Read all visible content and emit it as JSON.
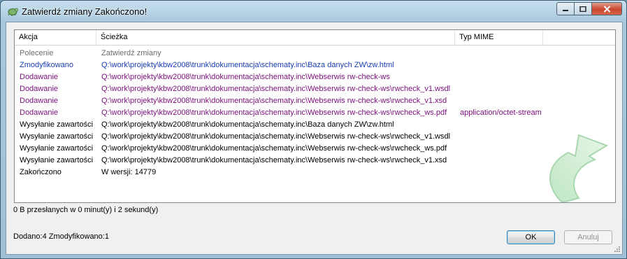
{
  "window": {
    "title": "Zatwierdź zmiany Zakończono!"
  },
  "list": {
    "columns": {
      "action": "Akcja",
      "path": "Ścieżka",
      "mime": "Typ MIME"
    },
    "rows": [
      {
        "action": "Polecenie",
        "path": "Zatwierdź zmiany",
        "mime": "",
        "style": "cmd"
      },
      {
        "action": "Zmodyfikowano",
        "path": "Q:\\work\\projekty\\kbw2008\\trunk\\dokumentacja\\schematy.inc\\Baza danych ZW\\zw.html",
        "mime": "",
        "style": "mod"
      },
      {
        "action": "Dodawanie",
        "path": "Q:\\work\\projekty\\kbw2008\\trunk\\dokumentacja\\schematy.inc\\Webserwis rw-check-ws",
        "mime": "",
        "style": "add"
      },
      {
        "action": "Dodawanie",
        "path": "Q:\\work\\projekty\\kbw2008\\trunk\\dokumentacja\\schematy.inc\\Webserwis rw-check-ws\\rwcheck_v1.wsdl",
        "mime": "",
        "style": "add"
      },
      {
        "action": "Dodawanie",
        "path": "Q:\\work\\projekty\\kbw2008\\trunk\\dokumentacja\\schematy.inc\\Webserwis rw-check-ws\\rwcheck_v1.xsd",
        "mime": "",
        "style": "add"
      },
      {
        "action": "Dodawanie",
        "path": "Q:\\work\\projekty\\kbw2008\\trunk\\dokumentacja\\schematy.inc\\Webserwis rw-check-ws\\rwcheck_ws.pdf",
        "mime": "application/octet-stream",
        "style": "add"
      },
      {
        "action": "Wysyłanie zawartości",
        "path": "Q:\\work\\projekty\\kbw2008\\trunk\\dokumentacja\\schematy.inc\\Baza danych ZW\\zw.html",
        "mime": "",
        "style": "norm"
      },
      {
        "action": "Wysyłanie zawartości",
        "path": "Q:\\work\\projekty\\kbw2008\\trunk\\dokumentacja\\schematy.inc\\Webserwis rw-check-ws\\rwcheck_v1.wsdl",
        "mime": "",
        "style": "norm"
      },
      {
        "action": "Wysyłanie zawartości",
        "path": "Q:\\work\\projekty\\kbw2008\\trunk\\dokumentacja\\schematy.inc\\Webserwis rw-check-ws\\rwcheck_ws.pdf",
        "mime": "",
        "style": "norm"
      },
      {
        "action": "Wysyłanie zawartości",
        "path": "Q:\\work\\projekty\\kbw2008\\trunk\\dokumentacja\\schematy.inc\\Webserwis rw-check-ws\\rwcheck_v1.xsd",
        "mime": "",
        "style": "norm"
      },
      {
        "action": "Zakończono",
        "path": "W wersji: 14779",
        "mime": "",
        "style": "norm"
      }
    ]
  },
  "status": {
    "transfer": "0 B przesłanych w 0 minut(y) i 2 sekund(y)",
    "summary": "Dodano:4 Zmodyfikowano:1"
  },
  "buttons": {
    "ok_label": "OK",
    "cancel_label": "Anuluj"
  },
  "icons": {
    "app": "tortoisesvn-icon",
    "minimize": "minimize-icon",
    "maximize": "maximize-icon",
    "close": "close-icon",
    "watermark": "commit-arrow-icon"
  }
}
